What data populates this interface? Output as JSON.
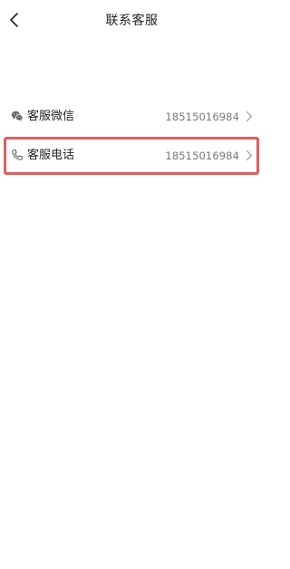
{
  "header": {
    "title": "联系客服",
    "back_icon": "chevron-left-icon"
  },
  "contacts": [
    {
      "label": "客服微信",
      "value": "18515016984",
      "icon": "wechat-icon",
      "highlighted": false
    },
    {
      "label": "客服电话",
      "value": "18515016984",
      "icon": "phone-icon",
      "highlighted": true
    }
  ],
  "colors": {
    "highlight_border": "#e35d5d",
    "value_text": "#777777",
    "label_text": "#222222",
    "chevron": "#999999"
  }
}
